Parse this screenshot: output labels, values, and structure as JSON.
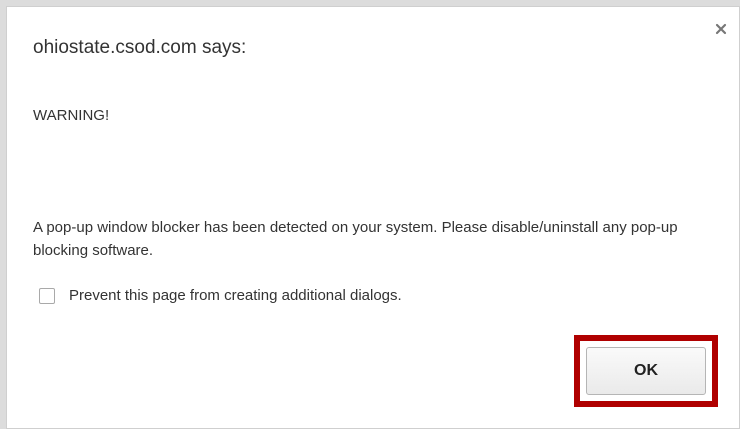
{
  "dialog": {
    "title": "ohiostate.csod.com says:",
    "warning": "WARNING!",
    "message": "A pop-up window blocker has been detected on your system.  Please disable/uninstall any pop-up blocking software.",
    "prevent_checkbox": {
      "label": "Prevent this page from creating additional dialogs.",
      "checked": false
    },
    "ok_label": "OK",
    "close_icon": "close-icon"
  },
  "colors": {
    "highlight": "#b00000",
    "text": "#333333",
    "background": "#ffffff"
  }
}
